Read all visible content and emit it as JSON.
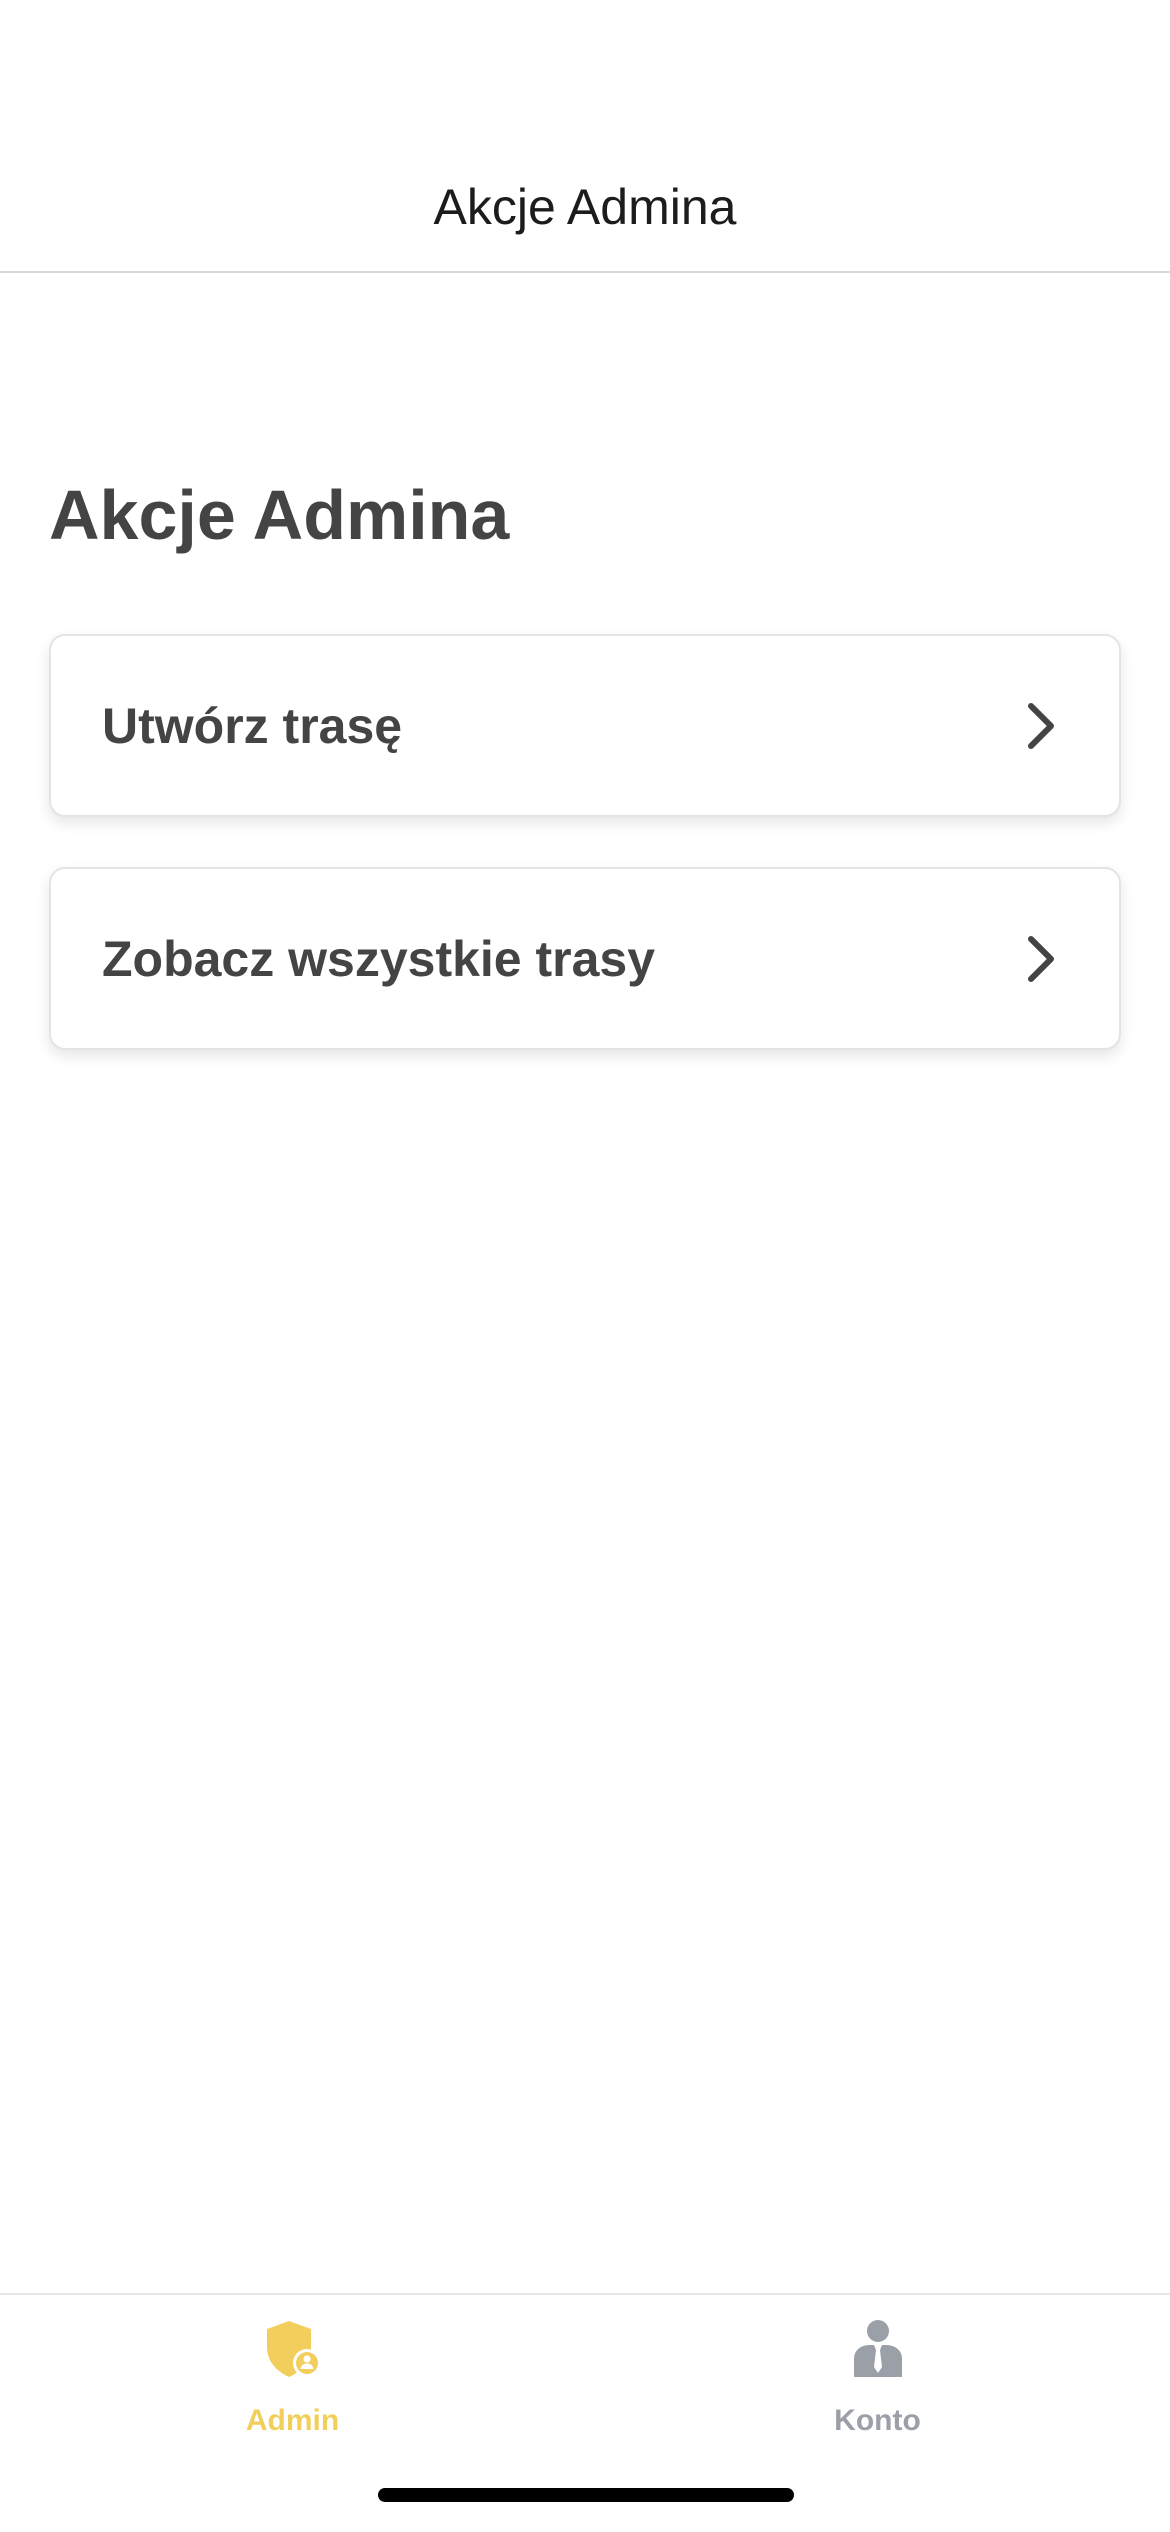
{
  "nav": {
    "title": "Akcje Admina"
  },
  "main": {
    "heading": "Akcje Admina",
    "actions": [
      {
        "label": "Utwórz trasę",
        "icon": "chevron-right-icon"
      },
      {
        "label": "Zobacz wszystkie trasy",
        "icon": "chevron-right-icon"
      }
    ]
  },
  "tabbar": {
    "tabs": [
      {
        "label": "Admin",
        "icon": "admin-shield-icon",
        "active": true,
        "color": "#f2cf5c"
      },
      {
        "label": "Konto",
        "icon": "account-person-icon",
        "active": false,
        "color": "#9a9fa8"
      }
    ]
  }
}
